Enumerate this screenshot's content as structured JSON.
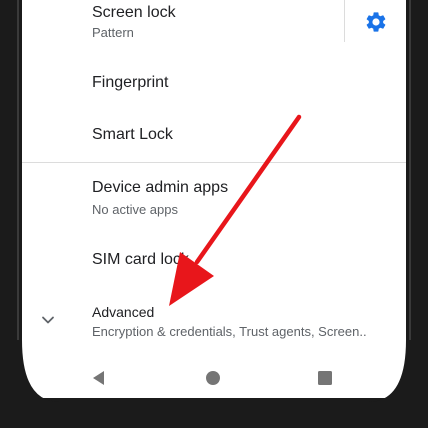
{
  "settings": {
    "items": [
      {
        "title": "Screen lock",
        "summary": "Pattern"
      },
      {
        "title": "Fingerprint"
      },
      {
        "title": "Smart Lock"
      },
      {
        "title": "Device admin apps",
        "summary": "No active apps"
      },
      {
        "title": "SIM card lock"
      },
      {
        "title": "Advanced",
        "summary": "Encryption & credentials, Trust agents, Screen.."
      }
    ]
  },
  "icons": {
    "settings": "gear-icon",
    "expand": "chevron-down-icon",
    "back": "back-triangle-icon",
    "home": "home-circle-icon",
    "recents": "recents-square-icon"
  },
  "colors": {
    "accent": "#1a73e8",
    "annotation_arrow": "#e8161b",
    "text_primary": "#202124",
    "text_secondary": "#5f6368",
    "nav_icon": "#757575"
  }
}
